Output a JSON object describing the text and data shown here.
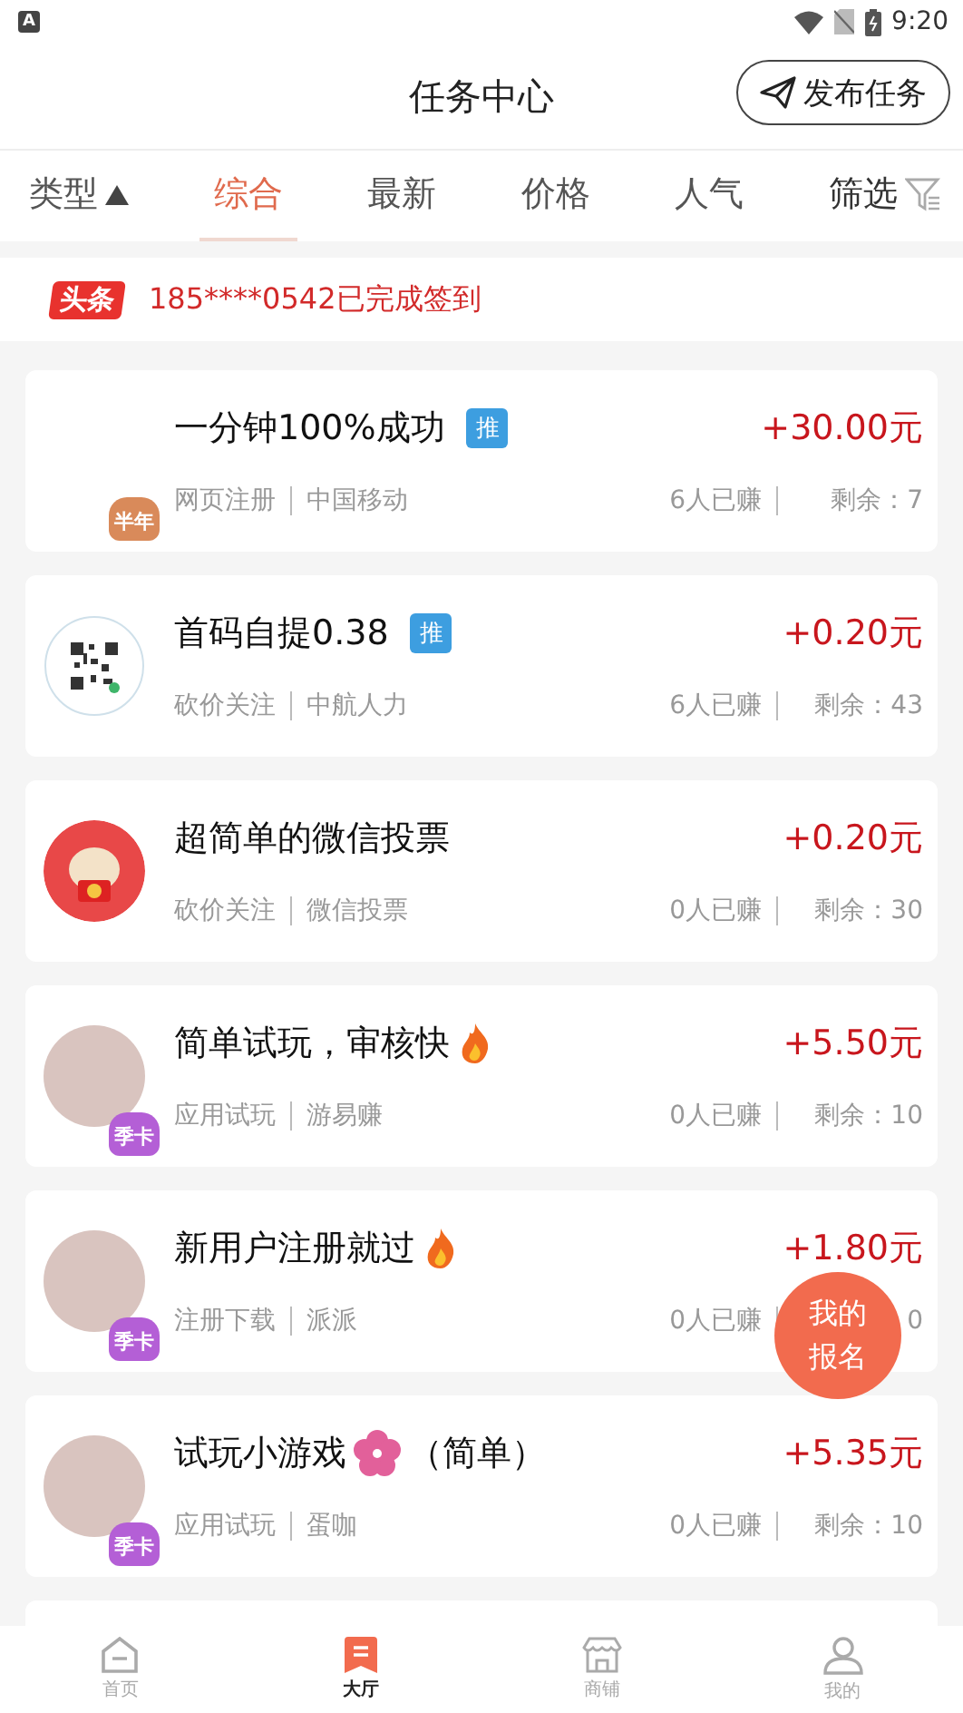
{
  "status_bar": {
    "time": "9:20",
    "notification": "A"
  },
  "header": {
    "title": "任务中心",
    "publish_button": "发布任务"
  },
  "tabs": [
    {
      "label": "类型",
      "kind": "dropdown",
      "selected": false
    },
    {
      "label": "综合",
      "kind": "plain",
      "selected": true
    },
    {
      "label": "最新",
      "kind": "plain",
      "selected": false
    },
    {
      "label": "价格",
      "kind": "plain",
      "selected": false
    },
    {
      "label": "人气",
      "kind": "plain",
      "selected": false
    },
    {
      "label": "筛选",
      "kind": "filter",
      "selected": false
    }
  ],
  "ticker": {
    "tag": "头条",
    "text": "185****0542已完成签到"
  },
  "tasks": [
    {
      "kind": "blank",
      "title": "一分钟100%成功",
      "recommended": true,
      "tag": "推",
      "badge": {
        "label": "半年",
        "color": "#d98a5a"
      },
      "category": "网页注册",
      "company": "中国移动",
      "earned": "6人已赚",
      "remaining": "剩余：7",
      "reward": "+30.00元"
    },
    {
      "kind": "qr",
      "title": "首码自提0.38",
      "recommended": true,
      "tag": "推",
      "category": "砍价关注",
      "company": "中航人力",
      "earned": "6人已赚",
      "remaining": "剩余：43",
      "reward": "+0.20元"
    },
    {
      "kind": "cartoon",
      "title": "超简单的微信投票",
      "recommended": false,
      "category": "砍价关注",
      "company": "微信投票",
      "earned": "0人已赚",
      "remaining": "剩余：30",
      "reward": "+0.20元"
    },
    {
      "kind": "photo",
      "title": "简单试玩，审核快",
      "title_mark": {
        "kind": "fire"
      },
      "recommended": false,
      "badge": {
        "label": "季卡",
        "color": "#b45fd6"
      },
      "category": "应用试玩",
      "company": "游易赚",
      "earned": "0人已赚",
      "remaining": "剩余：10",
      "reward": "+5.50元"
    },
    {
      "kind": "photo",
      "title": "新用户注册就过",
      "title_mark": {
        "kind": "fire"
      },
      "recommended": false,
      "badge": {
        "label": "季卡",
        "color": "#b45fd6"
      },
      "category": "注册下载",
      "company": "派派",
      "earned": "0人已赚",
      "remaining": "0",
      "reward": "+1.80元"
    },
    {
      "kind": "photo",
      "title": "试玩小游戏",
      "title_mark": {
        "kind": "flower"
      },
      "title_suffix": "（简单）",
      "recommended": false,
      "badge": {
        "label": "季卡",
        "color": "#b45fd6"
      },
      "category": "应用试玩",
      "company": "蛋咖",
      "earned": "0人已赚",
      "remaining": "剩余：10",
      "reward": "+5.35元"
    }
  ],
  "fab": {
    "line1": "我的",
    "line2": "报名"
  },
  "bottom_nav": [
    {
      "label": "首页",
      "kind": "home",
      "selected": false
    },
    {
      "label": "大厅",
      "kind": "hall",
      "selected": true
    },
    {
      "label": "商铺",
      "kind": "shop",
      "selected": false
    },
    {
      "label": "我的",
      "kind": "user",
      "selected": false
    }
  ]
}
